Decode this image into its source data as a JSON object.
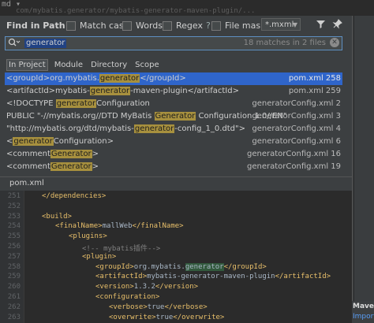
{
  "background": {
    "top_path": "md  ▾",
    "path_text": "com/mybatis.generator/mybatis-generator-maven-plugin/...",
    "maven_label": "Maven",
    "import_label": "Import"
  },
  "dialog": {
    "title": "Find in Path",
    "options": {
      "match_case": "Match case",
      "words": "Words",
      "regex": "Regex",
      "regex_help": "?",
      "file_mask": "File mask:",
      "file_mask_value": "*.mxml"
    },
    "search": {
      "value": "generator",
      "match_count": "18 matches in 2 files"
    },
    "scopes": [
      {
        "label": "In Project",
        "active": true
      },
      {
        "label": "Module",
        "active": false
      },
      {
        "label": "Directory",
        "active": false
      },
      {
        "label": "Scope",
        "active": false
      }
    ],
    "results": [
      {
        "pre": "<groupId>org.mybatis.",
        "hl": "generator",
        "post": "</groupId>",
        "file": "pom.xml 258",
        "selected": true
      },
      {
        "pre": "<artifactId>mybatis-",
        "hl": "generator",
        "post": "-maven-plugin</artifactId>",
        "file": "pom.xml 259",
        "selected": false
      },
      {
        "pre": "<!DOCTYPE ",
        "hl": "generator",
        "post": "Configuration",
        "file": "generatorConfig.xml 2",
        "selected": false
      },
      {
        "pre": "PUBLIC \"-//mybatis.org//DTD MyBatis ",
        "hl": "Generator",
        "post": " Configuration 1.0//EN\"",
        "file": "generatorConfig.xml 3",
        "selected": false
      },
      {
        "pre": "\"http://mybatis.org/dtd/mybatis-",
        "hl": "generator",
        "post": "-config_1_0.dtd\">",
        "file": "generatorConfig.xml 4",
        "selected": false
      },
      {
        "pre": "<",
        "hl": "generator",
        "post": "Configuration>",
        "file": "generatorConfig.xml 6",
        "selected": false
      },
      {
        "pre": "<comment",
        "hl": "Generator",
        "post": ">",
        "file": "generatorConfig.xml 16",
        "selected": false
      },
      {
        "pre": "<comment",
        "hl": "Generator",
        "post": ">",
        "file": "generatorConfig.xml 19",
        "selected": false
      }
    ],
    "preview_tab": "pom.xml"
  },
  "editor": {
    "lines": [
      {
        "n": "251",
        "indent": 1,
        "parts": [
          {
            "c": "tag",
            "t": "</dependencies>"
          }
        ]
      },
      {
        "n": "252",
        "indent": 0,
        "parts": []
      },
      {
        "n": "253",
        "indent": 1,
        "parts": [
          {
            "c": "tag",
            "t": "<build>"
          }
        ]
      },
      {
        "n": "254",
        "indent": 2,
        "parts": [
          {
            "c": "tag",
            "t": "<finalName>"
          },
          {
            "c": "txt",
            "t": "mallWeb"
          },
          {
            "c": "tag",
            "t": "</finalName>"
          }
        ]
      },
      {
        "n": "255",
        "indent": 3,
        "parts": [
          {
            "c": "tag",
            "t": "<plugins>"
          }
        ]
      },
      {
        "n": "256",
        "indent": 4,
        "parts": [
          {
            "c": "cmt",
            "t": "<!-- mybatis插件-->"
          }
        ]
      },
      {
        "n": "257",
        "indent": 4,
        "parts": [
          {
            "c": "tag",
            "t": "<plugin>"
          }
        ]
      },
      {
        "n": "258",
        "indent": 5,
        "parts": [
          {
            "c": "tag",
            "t": "<groupId>"
          },
          {
            "c": "txt",
            "t": "org.mybatis."
          },
          {
            "c": "ghl",
            "t": "generator"
          },
          {
            "c": "tag",
            "t": "</groupId>"
          }
        ]
      },
      {
        "n": "259",
        "indent": 5,
        "parts": [
          {
            "c": "tag",
            "t": "<artifactId>"
          },
          {
            "c": "txt",
            "t": "mybatis-generator-maven-plugin"
          },
          {
            "c": "tag",
            "t": "</artifactId>"
          }
        ]
      },
      {
        "n": "260",
        "indent": 5,
        "parts": [
          {
            "c": "tag",
            "t": "<version>"
          },
          {
            "c": "txt",
            "t": "1.3.2"
          },
          {
            "c": "tag",
            "t": "</version>"
          }
        ]
      },
      {
        "n": "261",
        "indent": 5,
        "parts": [
          {
            "c": "tag",
            "t": "<configuration>"
          }
        ]
      },
      {
        "n": "262",
        "indent": 6,
        "parts": [
          {
            "c": "tag",
            "t": "<verbose>"
          },
          {
            "c": "txt",
            "t": "true"
          },
          {
            "c": "tag",
            "t": "</verbose>"
          }
        ]
      },
      {
        "n": "263",
        "indent": 6,
        "parts": [
          {
            "c": "tag",
            "t": "<overwrite>"
          },
          {
            "c": "txt",
            "t": "true"
          },
          {
            "c": "tag",
            "t": "</overwrite>"
          }
        ]
      }
    ]
  }
}
